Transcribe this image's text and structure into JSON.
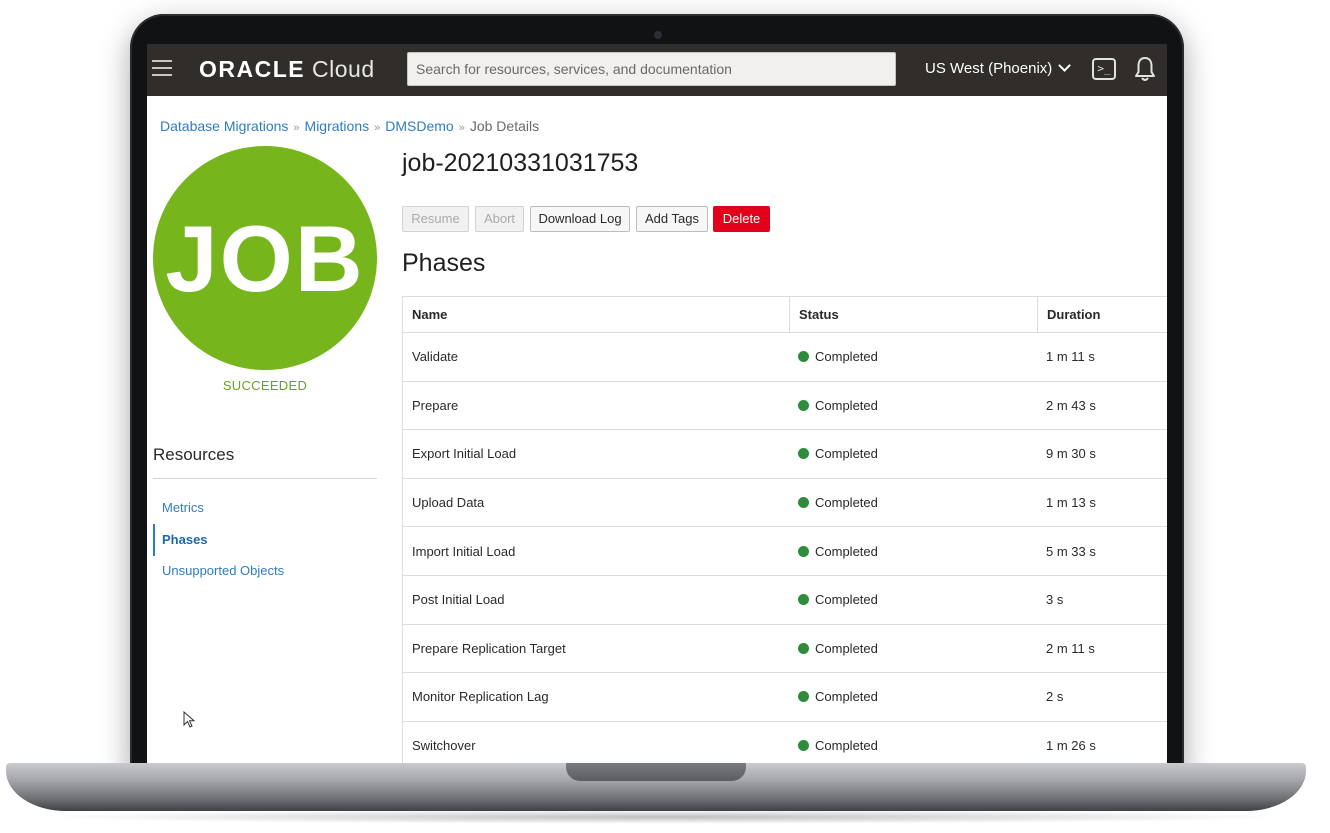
{
  "header": {
    "brand_primary": "ORACLE",
    "brand_secondary": "Cloud",
    "search_placeholder": "Search for resources, services, and documentation",
    "region": "US West (Phoenix)",
    "cloudshell_glyph": ">_"
  },
  "breadcrumb": {
    "items": [
      "Database Migrations",
      "Migrations",
      "DMSDemo"
    ],
    "current": "Job Details",
    "separator": "»"
  },
  "job": {
    "badge_text": "JOB",
    "status": "SUCCEEDED",
    "title": "job-20210331031753",
    "badge_color": "#76b51b"
  },
  "actions": {
    "resume": "Resume",
    "abort": "Abort",
    "download_log": "Download Log",
    "add_tags": "Add Tags",
    "delete": "Delete"
  },
  "resources": {
    "title": "Resources",
    "items": [
      {
        "label": "Metrics",
        "active": false
      },
      {
        "label": "Phases",
        "active": true
      },
      {
        "label": "Unsupported Objects",
        "active": false
      }
    ]
  },
  "phases": {
    "title": "Phases",
    "columns": [
      "Name",
      "Status",
      "Duration"
    ],
    "rows": [
      {
        "name": "Validate",
        "status": "Completed",
        "duration": "1 m 11 s"
      },
      {
        "name": "Prepare",
        "status": "Completed",
        "duration": "2 m 43 s"
      },
      {
        "name": "Export Initial Load",
        "status": "Completed",
        "duration": "9 m 30 s"
      },
      {
        "name": "Upload Data",
        "status": "Completed",
        "duration": "1 m 13 s"
      },
      {
        "name": "Import Initial Load",
        "status": "Completed",
        "duration": "5 m 33 s"
      },
      {
        "name": "Post Initial Load",
        "status": "Completed",
        "duration": "3 s"
      },
      {
        "name": "Prepare Replication Target",
        "status": "Completed",
        "duration": "2 m 11 s"
      },
      {
        "name": "Monitor Replication Lag",
        "status": "Completed",
        "duration": "2 s"
      },
      {
        "name": "Switchover",
        "status": "Completed",
        "duration": "1 m 26 s"
      }
    ],
    "status_color": "#2e8b3c"
  }
}
